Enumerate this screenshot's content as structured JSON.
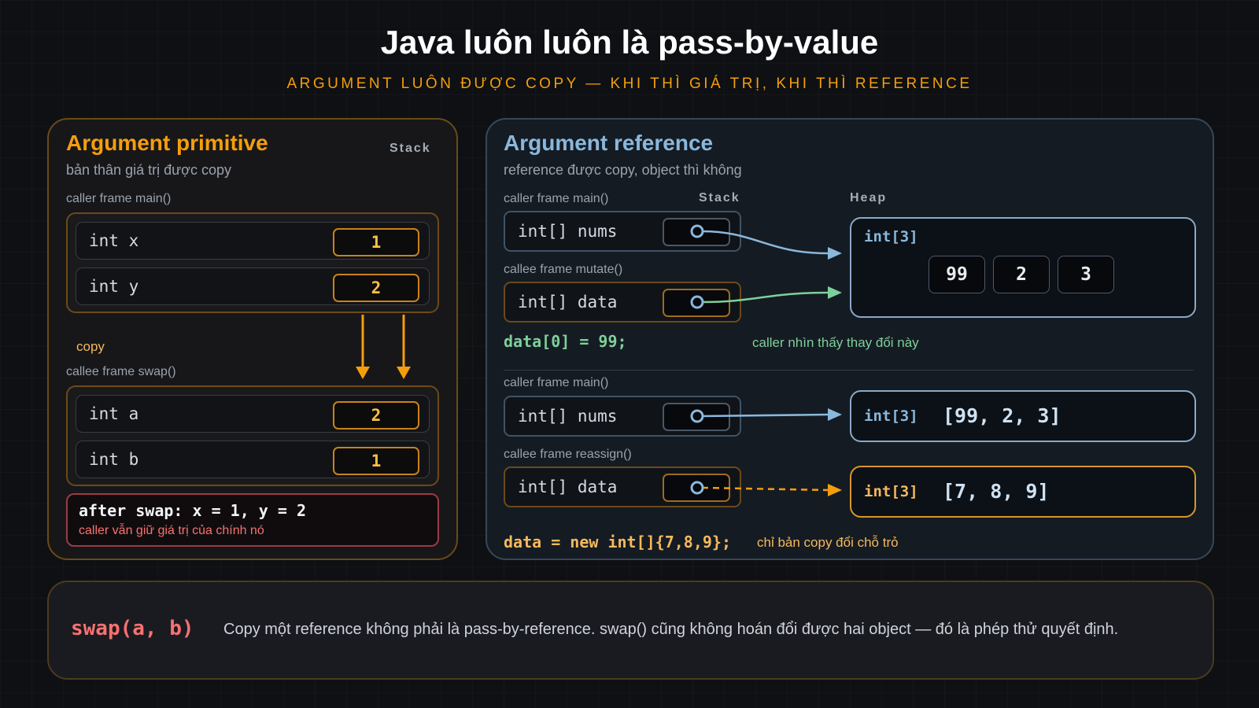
{
  "header": {
    "title": "Java luôn luôn là pass-by-value",
    "subtitle": "ARGUMENT LUÔN ĐƯỢC COPY — KHI THÌ GIÁ TRỊ, KHI THÌ REFERENCE"
  },
  "primitive": {
    "title": "Argument primitive",
    "subtitle": "bản thân giá trị được copy",
    "stack_label": "Stack",
    "caller_label": "caller frame main()",
    "caller_rows": [
      {
        "name": "int x",
        "value": "1"
      },
      {
        "name": "int y",
        "value": "2"
      }
    ],
    "copy_label": "copy",
    "callee_label": "callee frame swap()",
    "callee_rows": [
      {
        "name": "int a",
        "value": "2"
      },
      {
        "name": "int b",
        "value": "1"
      }
    ],
    "after_code": "after swap: x = 1, y = 2",
    "after_note": "caller vẫn giữ giá trị của chính nó"
  },
  "reference": {
    "title": "Argument reference",
    "subtitle": "reference được copy, object thì không",
    "stack_label": "Stack",
    "heap_label": "Heap",
    "mutate": {
      "caller_label": "caller frame main()",
      "caller_var": "int[] nums",
      "callee_label": "callee frame mutate()",
      "callee_var": "int[] data",
      "heap_type": "int[3]",
      "heap_cells": [
        "99",
        "2",
        "3"
      ],
      "code": "data[0] = 99;",
      "note": "caller nhìn thấy thay đổi này"
    },
    "reassign": {
      "caller_label": "caller frame main()",
      "caller_var": "int[] nums",
      "callee_label": "callee frame reassign()",
      "callee_var": "int[] data",
      "heap1_type": "int[3]",
      "heap1_values": "[99, 2, 3]",
      "heap2_type": "int[3]",
      "heap2_values": "[7, 8, 9]",
      "code": "data = new int[]{7,8,9};",
      "note": "chỉ bản copy đổi chỗ trỏ"
    }
  },
  "footer": {
    "code": "swap(a, b)",
    "text": "Copy một reference không phải là pass-by-reference. swap() cũng không hoán đổi được hai object — đó là phép thử quyết định."
  },
  "colors": {
    "orange": "#f59e0b",
    "blue": "#8ab8dc",
    "green": "#7ed09a",
    "red": "#f87171",
    "background": "#0e1013"
  }
}
